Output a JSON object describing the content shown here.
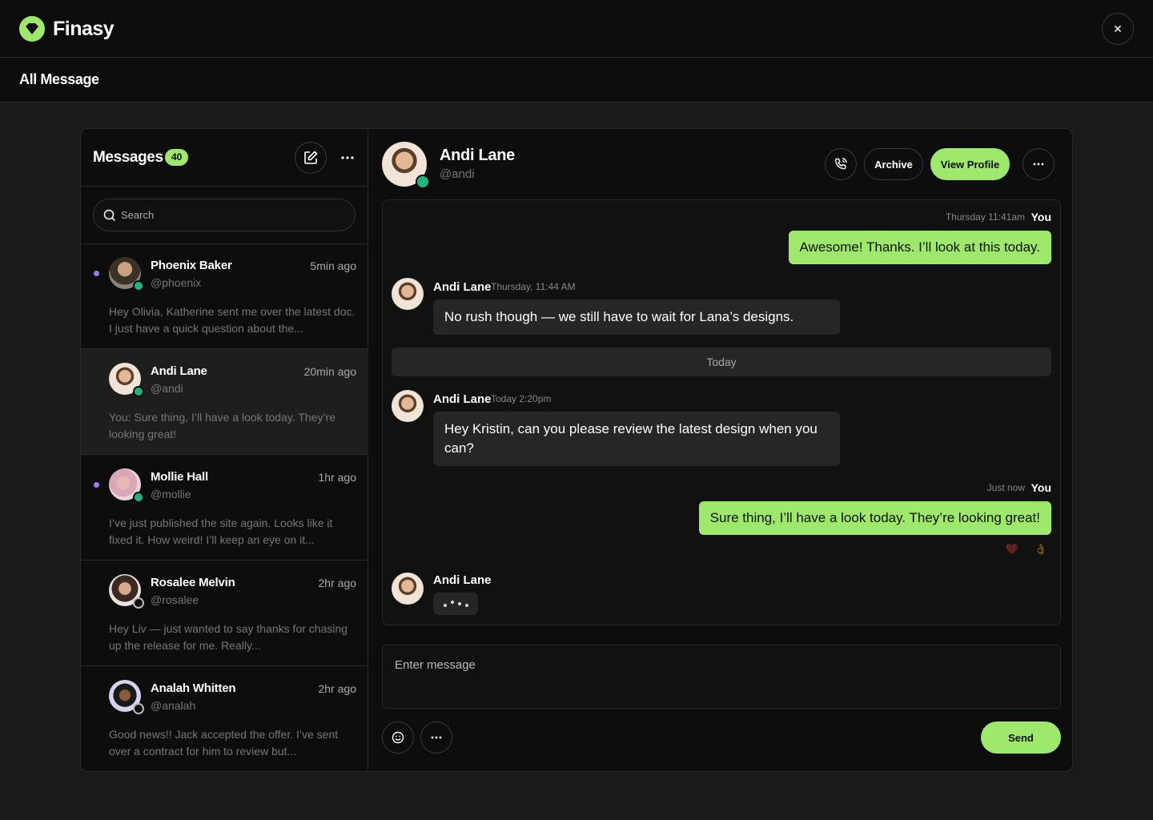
{
  "app": {
    "name": "Finasy",
    "page_title": "All Message",
    "close_label": "✕"
  },
  "colors": {
    "accent": "#9ee86c",
    "online": "#1fb57f",
    "unread": "#9b7cf2",
    "background": "#0d0d0d"
  },
  "sidebar": {
    "title": "Messages",
    "count": "40",
    "search_placeholder": "Search",
    "conversations": [
      {
        "name": "Phoenix Baker",
        "handle": "@phoenix",
        "time": "5min ago",
        "preview": "Hey Olivia, Katherine sent me over the latest doc. I just have a quick question about the...",
        "unread": true,
        "online": true
      },
      {
        "name": "Andi Lane",
        "handle": "@andi",
        "time": "20min ago",
        "preview": "You: Sure thing, I’ll have a look today. They’re looking great!",
        "unread": false,
        "online": true
      },
      {
        "name": "Mollie Hall",
        "handle": "@mollie",
        "time": "1hr ago",
        "preview": "I’ve just published the site again. Looks like it fixed it. How weird! I’ll keep an eye on it...",
        "unread": true,
        "online": true
      },
      {
        "name": "Rosalee Melvin",
        "handle": "@rosalee",
        "time": "2hr ago",
        "preview": "Hey Liv — just wanted to say thanks for chasing up the release for me. Really...",
        "unread": false,
        "online": false
      },
      {
        "name": "Analah Whitten",
        "handle": "@analah",
        "time": "2hr ago",
        "preview": "Good news!! Jack accepted the offer. I’ve sent over a contract for him to review but...",
        "unread": false,
        "online": false
      }
    ]
  },
  "chat_header": {
    "name": "Andi Lane",
    "handle": "@andi",
    "archive_label": "Archive",
    "view_profile_label": "View Profile"
  },
  "messages": {
    "m1": {
      "meta": "Thursday 11:41am",
      "sender": "You",
      "text": "Awesome! Thanks. I’ll look at this today."
    },
    "m2": {
      "sender": "Andi Lane",
      "meta": "Thursday, 11:44 AM",
      "text": "No rush though — we still have to wait for Lana’s designs."
    },
    "divider": "Today",
    "m3": {
      "sender": "Andi Lane",
      "meta": "Today 2:20pm",
      "text": "Hey Kristin, can you please review the latest design when you can?"
    },
    "m4": {
      "meta": "Just now",
      "sender": "You",
      "text": "Sure thing, I’ll have a look today. They’re looking great!",
      "reactions": [
        "❤️",
        "👌"
      ]
    },
    "typing": {
      "sender": "Andi Lane"
    }
  },
  "composer": {
    "placeholder": "Enter message",
    "send_label": "Send"
  }
}
